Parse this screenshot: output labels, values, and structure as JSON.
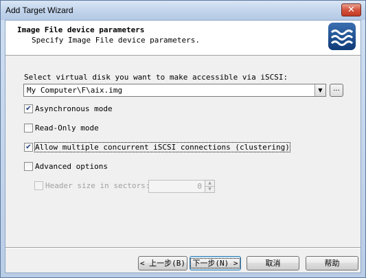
{
  "window": {
    "title": "Add Target Wizard",
    "close_glyph": "✕"
  },
  "header": {
    "title": "Image File device parameters",
    "subtitle": "Specify Image File device parameters.",
    "logo_icon": "wave-logo-icon"
  },
  "form": {
    "select_label": "Select virtual disk you want to make accessible via iSCSI:",
    "disk_path": "My Computer\\F\\aix.img",
    "browse_label": "...",
    "options": [
      {
        "label": "Asynchronous mode",
        "checked": true
      },
      {
        "label": "Read-Only mode",
        "checked": false
      },
      {
        "label": "Allow multiple concurrent iSCSI connections (clustering)",
        "checked": true
      },
      {
        "label": "Advanced options",
        "checked": false
      }
    ],
    "header_size_label": "Header size in sectors:",
    "header_size_value": "0"
  },
  "buttons": {
    "back": "< 上一步(B)",
    "next": "下一步(N) >",
    "cancel": "取消",
    "help": "帮助"
  },
  "colors": {
    "accent": "#1c3f7d",
    "close": "#c23a24"
  }
}
